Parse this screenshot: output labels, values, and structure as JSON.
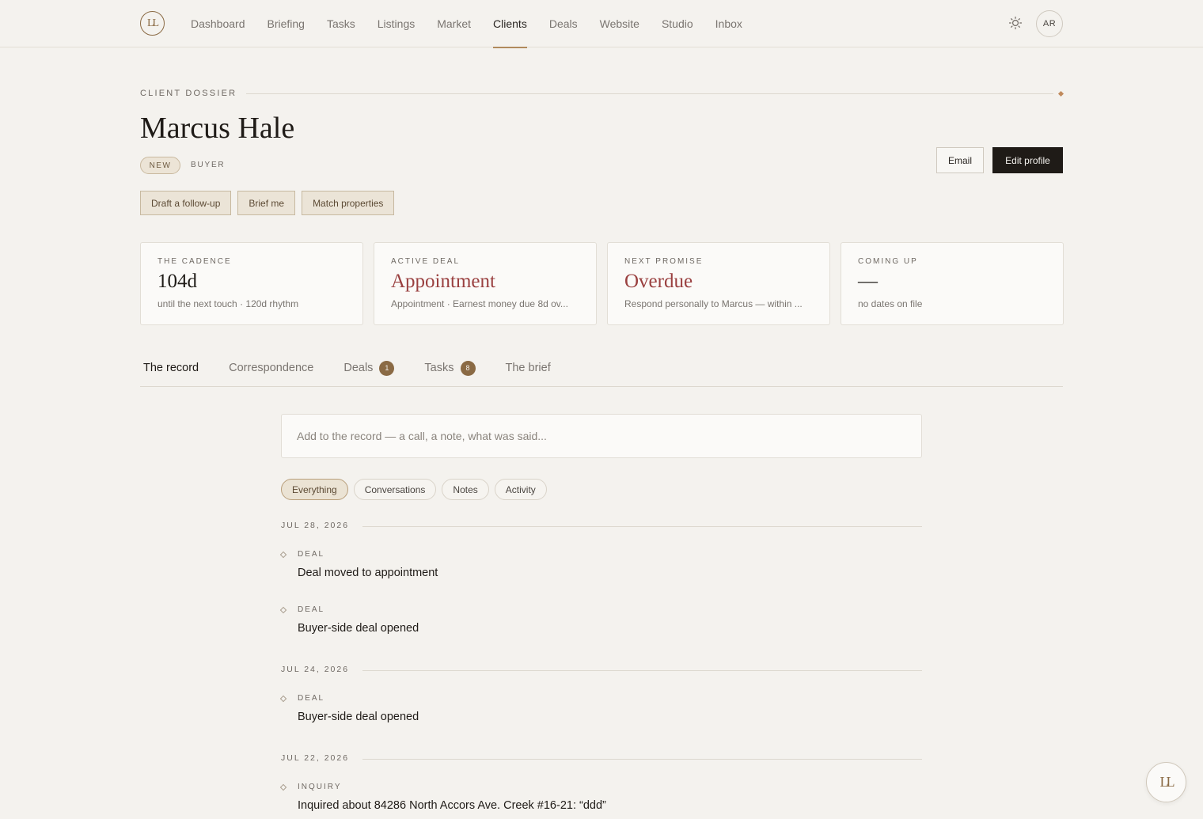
{
  "brand": {
    "logo_text": "LL"
  },
  "nav": {
    "items": [
      {
        "label": "Dashboard"
      },
      {
        "label": "Briefing"
      },
      {
        "label": "Tasks"
      },
      {
        "label": "Listings"
      },
      {
        "label": "Market"
      },
      {
        "label": "Clients",
        "active": true
      },
      {
        "label": "Deals"
      },
      {
        "label": "Website"
      },
      {
        "label": "Studio"
      },
      {
        "label": "Inbox"
      }
    ],
    "theme_icon": "sun-icon",
    "avatar_initials": "AR"
  },
  "header": {
    "eyebrow": "CLIENT DOSSIER",
    "name": "Marcus Hale",
    "status_badge": "NEW",
    "role": "BUYER",
    "email_label": "Email",
    "edit_label": "Edit profile"
  },
  "quick_actions": [
    {
      "label": "Draft a follow-up"
    },
    {
      "label": "Brief me"
    },
    {
      "label": "Match properties"
    }
  ],
  "cards": [
    {
      "label": "THE CADENCE",
      "value": "104d",
      "sub": "until the next touch · 120d rhythm",
      "alert": false
    },
    {
      "label": "ACTIVE DEAL",
      "value": "Appointment",
      "sub": "Appointment · Earnest money due 8d ov...",
      "alert": true
    },
    {
      "label": "NEXT PROMISE",
      "value": "Overdue",
      "sub": "Respond personally to Marcus — within ...",
      "alert": true
    },
    {
      "label": "COMING UP",
      "value": "—",
      "sub": "no dates on file",
      "alert": false
    }
  ],
  "tabs": [
    {
      "label": "The record",
      "active": true
    },
    {
      "label": "Correspondence"
    },
    {
      "label": "Deals",
      "count": "1"
    },
    {
      "label": "Tasks",
      "count": "8"
    },
    {
      "label": "The brief"
    }
  ],
  "record": {
    "placeholder": "Add to the record — a call, a note, what was said..."
  },
  "filters": [
    {
      "label": "Everything",
      "active": true
    },
    {
      "label": "Conversations"
    },
    {
      "label": "Notes"
    },
    {
      "label": "Activity"
    }
  ],
  "timeline": [
    {
      "date": "JUL 28, 2026",
      "events": [
        {
          "type": "DEAL",
          "text": "Deal moved to appointment"
        },
        {
          "type": "DEAL",
          "text": "Buyer-side deal opened"
        }
      ]
    },
    {
      "date": "JUL 24, 2026",
      "events": [
        {
          "type": "DEAL",
          "text": "Buyer-side deal opened"
        }
      ]
    },
    {
      "date": "JUL 22, 2026",
      "events": [
        {
          "type": "INQUIRY",
          "text": "Inquired about 84286 North Accors Ave. Creek #16-21: “ddd”"
        }
      ]
    }
  ],
  "fab": {
    "text": "LL"
  },
  "colors": {
    "background": "#f4f2ee",
    "accent": "#8a6a44",
    "alert": "#9a4040",
    "primary_button": "#1f1b17"
  }
}
